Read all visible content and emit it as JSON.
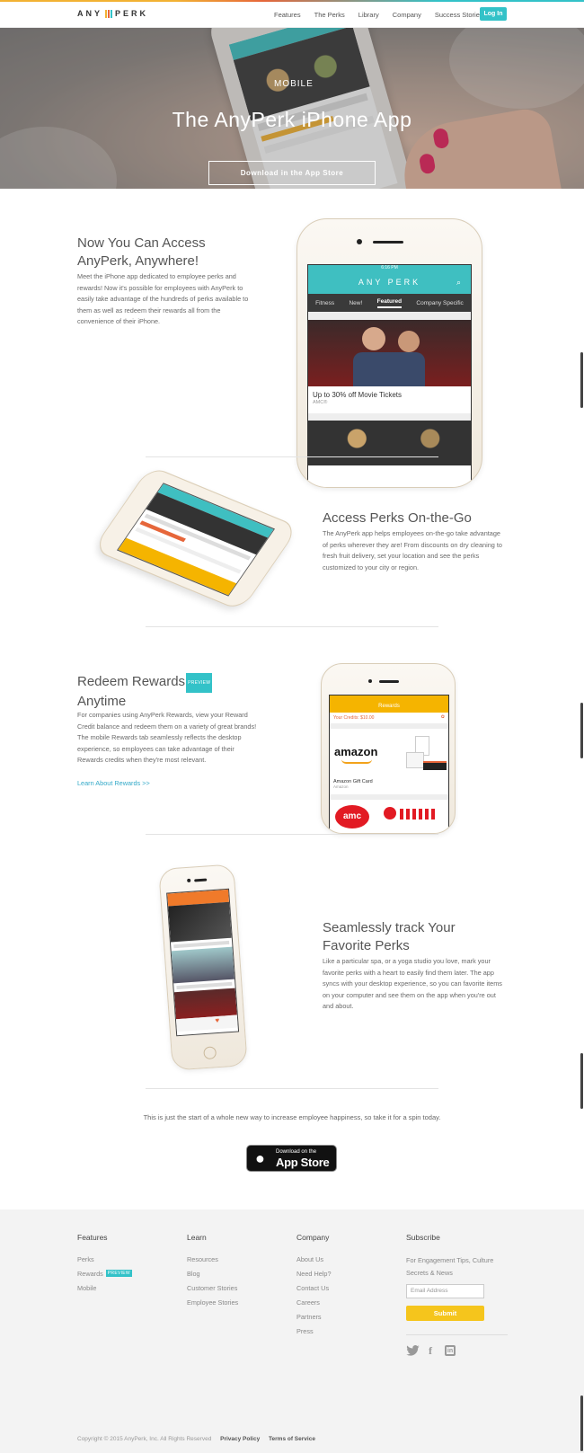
{
  "nav": {
    "brand_left": "ANY",
    "brand_right": "PERK",
    "links": [
      "Features",
      "The Perks",
      "Library",
      "Company",
      "Success Stories"
    ],
    "login": "Log In"
  },
  "hero": {
    "small_label": "MOBILE",
    "title": "The AnyPerk iPhone App",
    "button": "Download in the App Store"
  },
  "sections": {
    "access": {
      "title_l1": "Now You Can Access",
      "title_l2": "AnyPerk, Anywhere!",
      "body": "Meet the iPhone app dedicated to employee perks and rewards! Now it's possible for employees with AnyPerk to easily take advantage of the hundreds of perks available to them as well as redeem their rewards all from the convenience of their iPhone."
    },
    "onthego": {
      "title": "Access Perks On-the-Go",
      "body": "The AnyPerk app helps employees on-the-go take advantage of perks wherever they are! From discounts on dry cleaning to fresh fruit delivery, set your location and see the perks customized to your city or region."
    },
    "redeem": {
      "title_l1": "Redeem Rewards",
      "badge": "PREVIEW",
      "title_l2": "Anytime",
      "body": "For companies using AnyPerk Rewards, view your Reward Credit balance and redeem them on a variety of great brands! The mobile Rewards tab seamlessly reflects the desktop experience, so employees can take advantage of their Rewards credits when they're most relevant.",
      "link": "Learn About Rewards >>"
    },
    "track": {
      "title_l1": "Seamlessly track Your",
      "title_l2": "Favorite Perks",
      "body": "Like a particular spa, or a yoga studio you love, mark your favorite perks with a heart to easily find them later. The app syncs with your desktop experience, so you can favorite items on your computer and see them on the app when you're out and about."
    }
  },
  "phone1": {
    "time": "6:16 PM",
    "brand": "ANY PERK",
    "tabs": [
      "Fitness",
      "New!",
      "Featured",
      "Company Specific"
    ],
    "active_tab": "Featured",
    "card_title": "Up to 30% off Movie Tickets",
    "card_sub": "AMC®"
  },
  "phone3": {
    "header": "Rewards",
    "credits": "Your Credits: $10.00",
    "item1_logo": "amazon",
    "item1_title": "Amazon Gift Card",
    "item1_sub": "Amazon",
    "item2_logo": "amc"
  },
  "cta": {
    "text": "This is just the start of a whole new way to increase employee happiness, so take it for a spin today.",
    "store_small": "Download on the",
    "store_big": "App Store"
  },
  "footer": {
    "cols": [
      {
        "head": "Features",
        "items": [
          "Perks",
          "Rewards",
          "Mobile"
        ]
      },
      {
        "head": "Learn",
        "items": [
          "Resources",
          "Blog",
          "Customer Stories",
          "Employee Stories"
        ]
      },
      {
        "head": "Company",
        "items": [
          "About Us",
          "Need Help?",
          "Contact Us",
          "Careers",
          "Partners",
          "Press"
        ]
      }
    ],
    "rewards_badge": "PREVIEW",
    "subscribe_head": "Subscribe",
    "subscribe_text_l1": "For Engagement Tips, Culture",
    "subscribe_text_l2": "Secrets & News",
    "email_placeholder": "Email Address",
    "submit": "Submit",
    "copyright": "Copyright © 2015 AnyPerk, Inc. All Rights Reserved",
    "privacy": "Privacy Policy",
    "terms": "Terms of Service"
  },
  "colors": {
    "accent": "#33c2c8",
    "yellow": "#f5c51c",
    "orange": "#e6663a"
  }
}
